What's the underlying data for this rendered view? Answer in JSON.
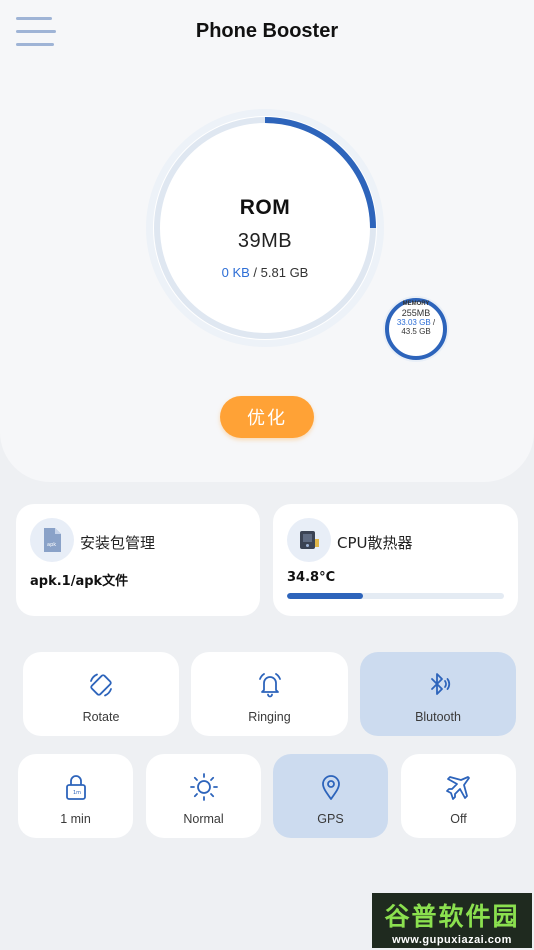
{
  "header": {
    "title": "Phone Booster",
    "menu_icon": "hamburger-menu-icon"
  },
  "rom": {
    "title": "ROM",
    "size": "39MB",
    "used": "0 KB",
    "separator": " / ",
    "total": "5.81 GB",
    "usage_fraction": 0.25,
    "color": "#2d64bb"
  },
  "memory": {
    "label": "MEMORY",
    "size": "255MB",
    "used": "33.03 GB",
    "separator": " /",
    "total": "43.5 GB",
    "color": "#2d64bb"
  },
  "optimize_button": {
    "label": "优化",
    "color": "#ffa236"
  },
  "cards": {
    "apk": {
      "icon": "apk-file-icon",
      "title": "安装包管理",
      "subtitle": "apk.1/apk文件"
    },
    "cpu": {
      "icon": "cpu-chip-icon",
      "title": "CPU散热器",
      "temperature": "34.8°C",
      "level_fraction": 0.35
    }
  },
  "toggles": [
    {
      "label": "Rotate",
      "icon": "rotate-icon",
      "active": false
    },
    {
      "label": "Ringing",
      "icon": "bell-icon",
      "active": false
    },
    {
      "label": "Blutooth",
      "icon": "bluetooth-icon",
      "active": true
    },
    {
      "label": "1 min",
      "icon": "lock-icon",
      "active": false
    },
    {
      "label": "Normal",
      "icon": "brightness-icon",
      "active": false
    },
    {
      "label": "GPS",
      "icon": "location-pin-icon",
      "active": true
    },
    {
      "label": "Off",
      "icon": "airplane-icon",
      "active": false
    }
  ],
  "watermark": {
    "main": "谷普软件园",
    "url": "www.gupuxiazai.com"
  }
}
